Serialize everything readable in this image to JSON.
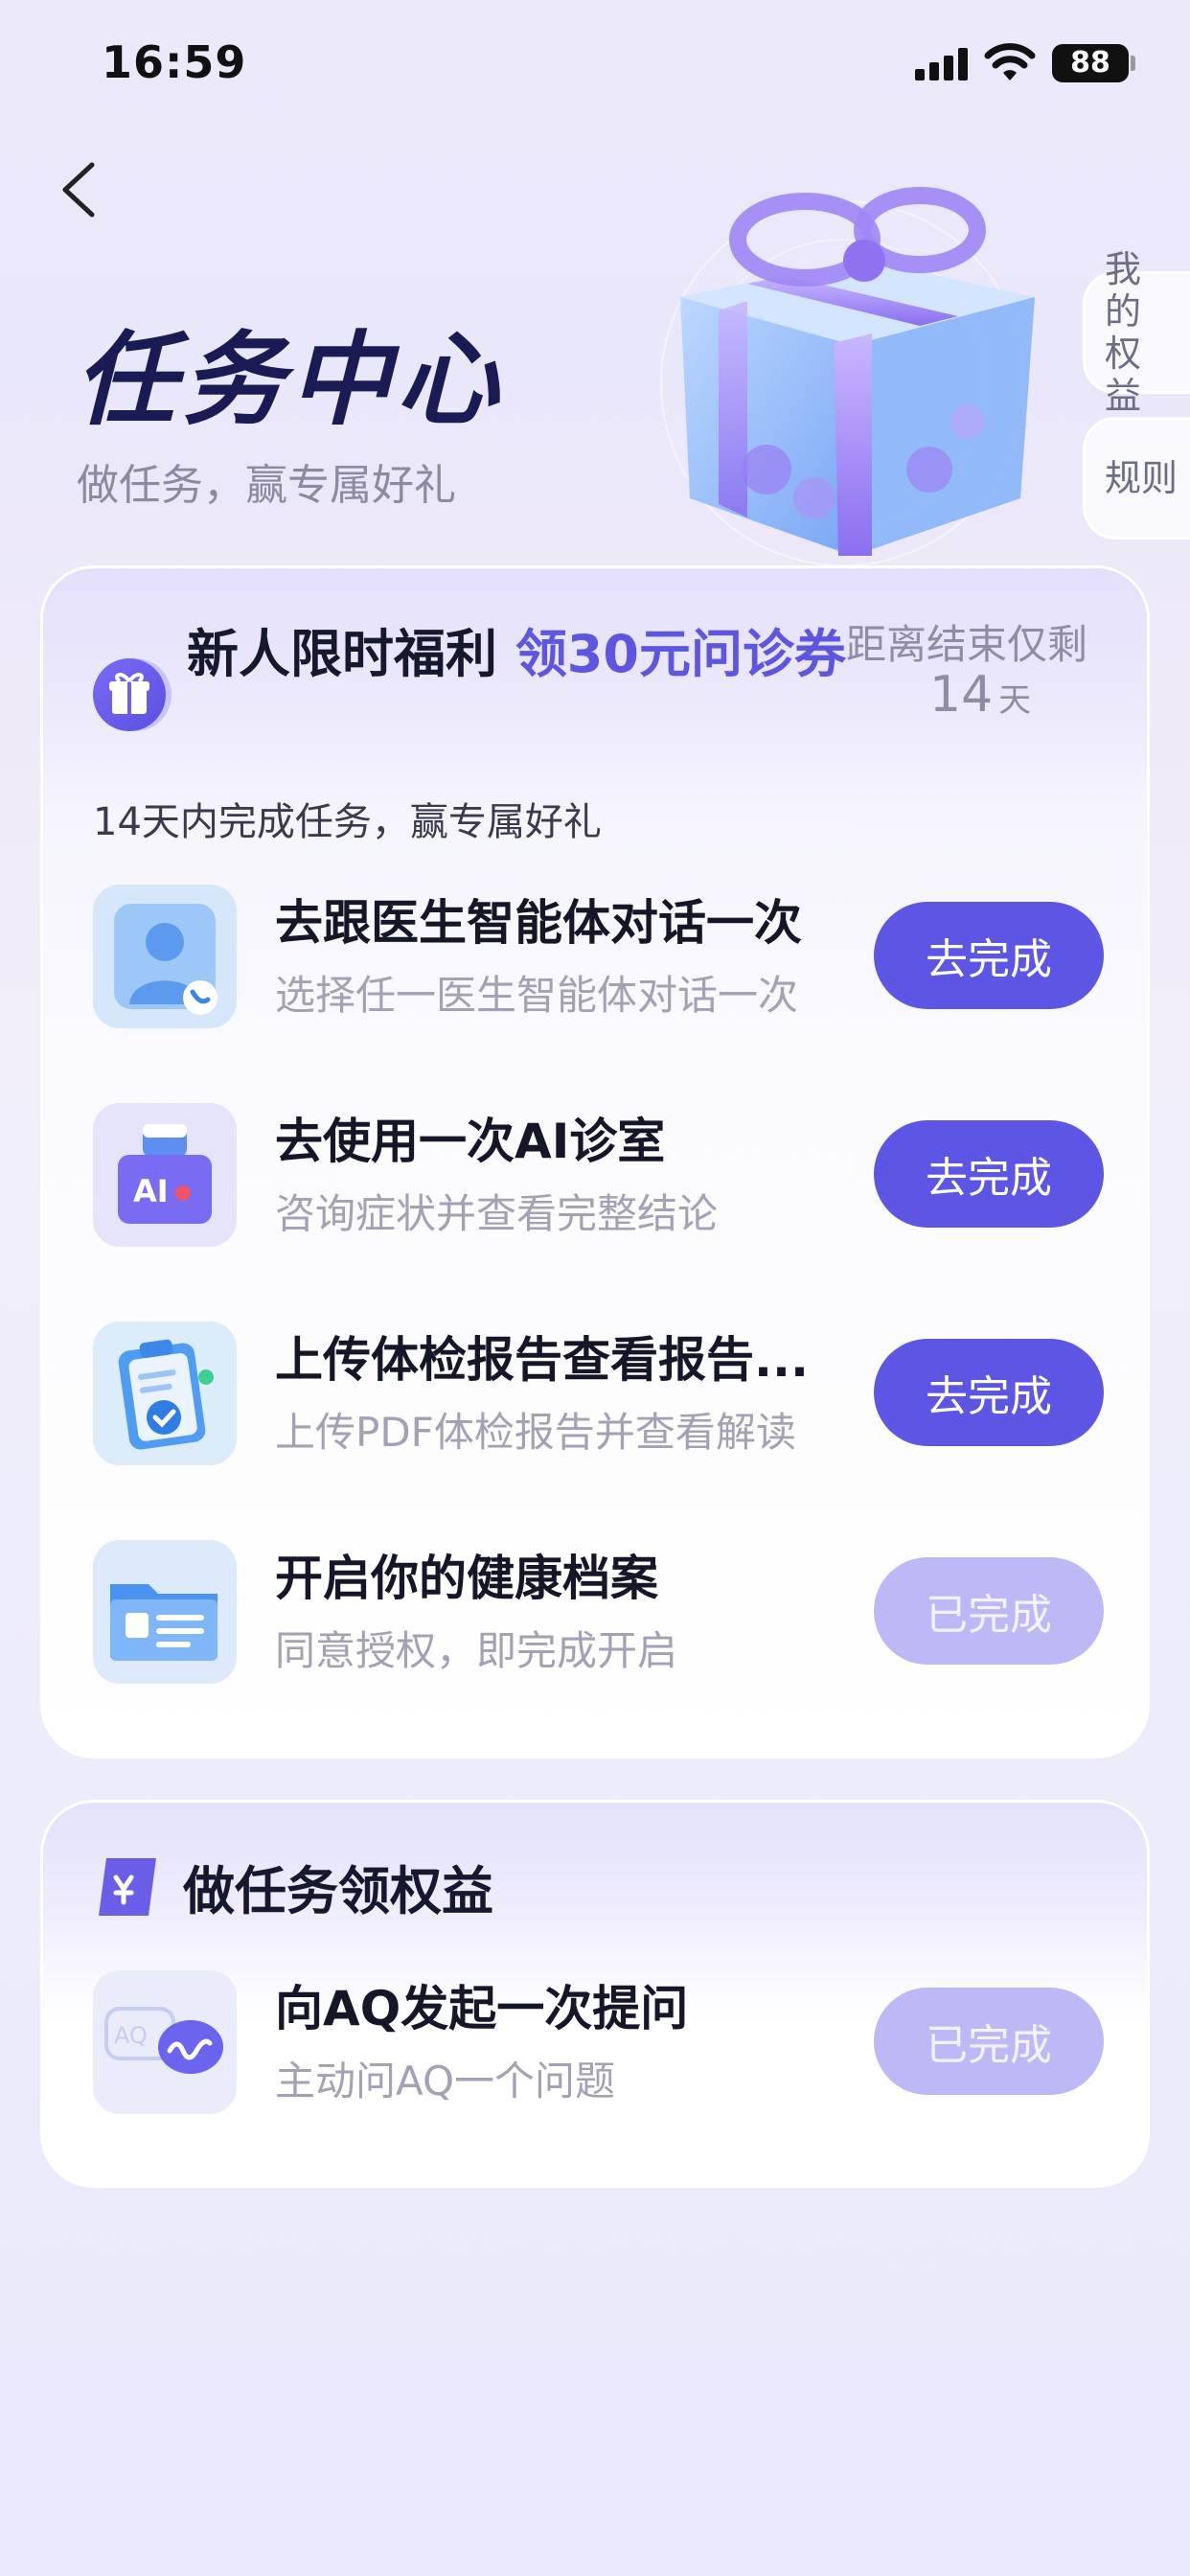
{
  "status_bar": {
    "time": "16:59",
    "battery": "88"
  },
  "header": {
    "title": "任务中心",
    "subtitle": "做任务，赢专属好礼"
  },
  "side_tabs": {
    "benefits": "我的权益",
    "rules": "规则"
  },
  "new_user_card": {
    "title_prefix": "新人限时福利 ",
    "title_accent": "领30元问诊券",
    "remain_label": "距离结束仅剩",
    "remain_value": "14",
    "remain_unit": "天",
    "subtitle": "14天内完成任务，赢专属好礼",
    "tasks": [
      {
        "name": "去跟医生智能体对话一次",
        "desc": "选择任一医生智能体对话一次",
        "button": "去完成",
        "icon": "doctor-icon"
      },
      {
        "name": "去使用一次AI诊室",
        "desc": "咨询症状并查看完整结论",
        "button": "去完成",
        "icon": "ai-clinic-icon"
      },
      {
        "name": "上传体检报告查看报告...",
        "desc": "上传PDF体检报告并查看解读",
        "button": "去完成",
        "icon": "clipboard-report-icon"
      },
      {
        "name": "开启你的健康档案",
        "desc": "同意授权，即完成开启",
        "button": "已完成",
        "icon": "health-folder-icon"
      }
    ]
  },
  "benefit_card": {
    "title": "做任务领权益",
    "tasks": [
      {
        "name": "向AQ发起一次提问",
        "desc": "主动问AQ一个问题",
        "button": "已完成",
        "icon": "chat-bubble-icon"
      }
    ]
  },
  "colors": {
    "accent": "#5d55e4",
    "done": "#bdb8f6",
    "title": "#1a1b55"
  }
}
